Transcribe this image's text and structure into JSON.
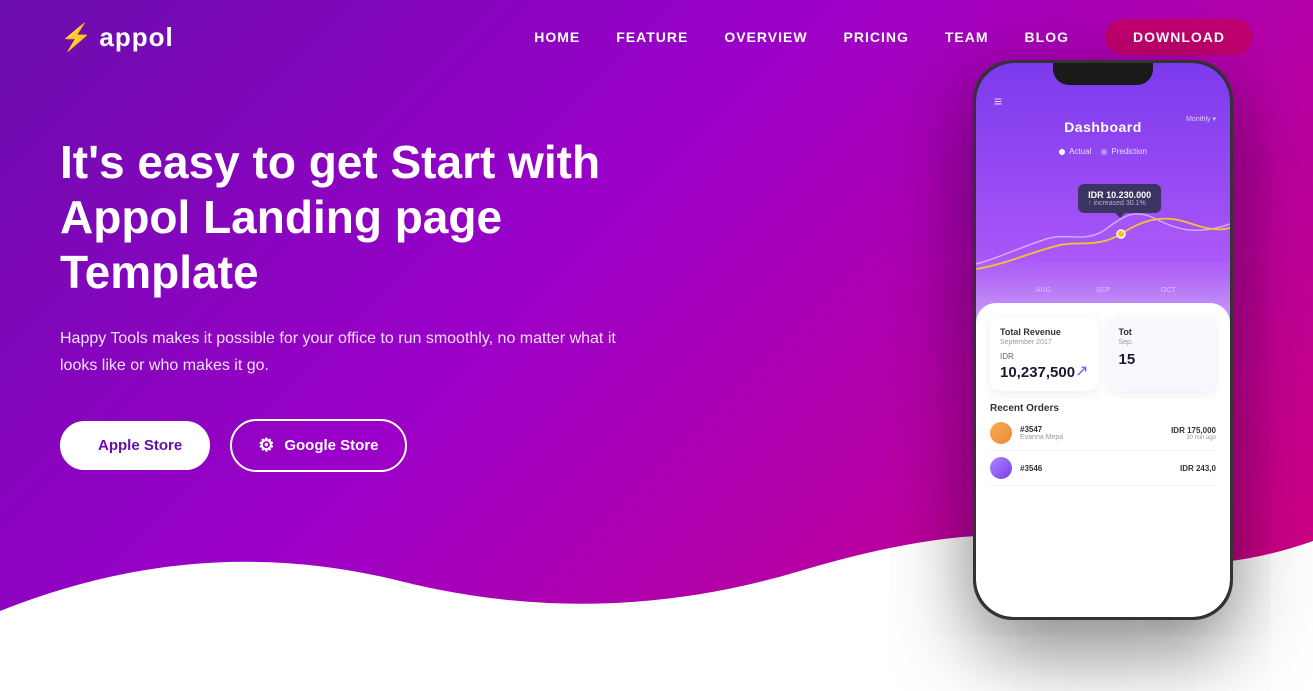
{
  "brand": {
    "name": "appol",
    "logo_icon": "⚡"
  },
  "nav": {
    "links": [
      {
        "label": "HOME",
        "href": "#"
      },
      {
        "label": "FEATURE",
        "href": "#"
      },
      {
        "label": "OVERVIEW",
        "href": "#"
      },
      {
        "label": "PRICING",
        "href": "#"
      },
      {
        "label": "TEAM",
        "href": "#"
      },
      {
        "label": "BLOG",
        "href": "#"
      },
      {
        "label": "DOWNLOAD",
        "href": "#",
        "is_cta": true
      }
    ]
  },
  "hero": {
    "title": "It's easy to get Start with Appol Landing page Template",
    "description": "Happy Tools makes it possible for your office to run smoothly, no matter what it looks like or who makes it go.",
    "apple_store_label": "Apple Store",
    "google_store_label": "Google Store"
  },
  "phone": {
    "dashboard_title": "Dashboard",
    "legend_actual": "Actual",
    "legend_prediction": "Prediction",
    "monthly_label": "Monthly ▾",
    "tooltip_amount": "IDR 10.230.000",
    "tooltip_sub": "↑ increased 30.1%",
    "card1_title": "Total Revenue",
    "card1_subtitle": "September 2017",
    "card1_currency": "IDR",
    "card1_amount": "10,237,500",
    "card2_title": "Tot",
    "card2_subtitle": "Sep.",
    "card2_amount": "15",
    "orders_title": "Recent Orders",
    "orders": [
      {
        "id": "#3547",
        "name": "Evanna Mepa",
        "amount": "IDR 175,000",
        "date": "30 min ago"
      },
      {
        "id": "#3546",
        "name": "",
        "amount": "IDR 243,0",
        "date": ""
      }
    ]
  },
  "colors": {
    "purple_dark": "#6a0dad",
    "purple_mid": "#9b00c9",
    "pink": "#d4007a",
    "download_btn": "#c0006e",
    "white": "#ffffff"
  }
}
